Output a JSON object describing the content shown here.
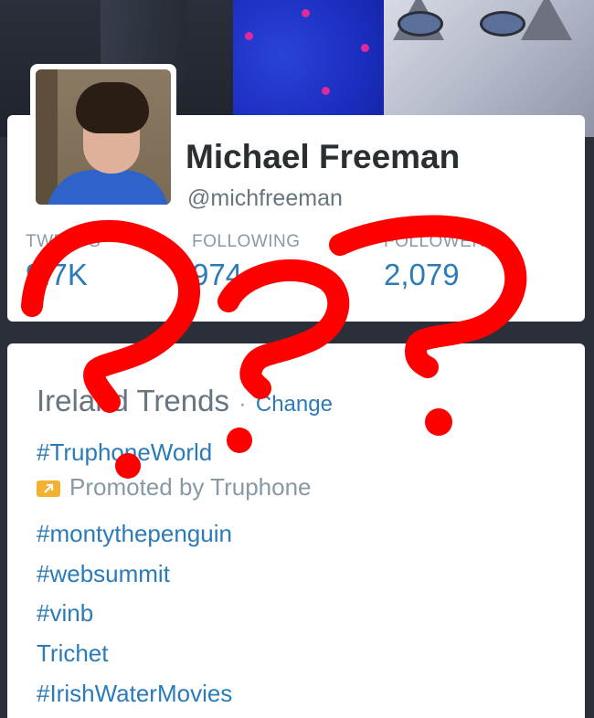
{
  "profile": {
    "name": "Michael Freeman",
    "handle": "@michfreeman",
    "stats": [
      {
        "label": "TWEETS",
        "value": "9.7K"
      },
      {
        "label": "FOLLOWING",
        "value": "974"
      },
      {
        "label": "FOLLOWERS",
        "value": "2,079"
      }
    ]
  },
  "trends": {
    "title": "Ireland Trends",
    "separator": "·",
    "change_label": "Change",
    "promoted_tag": "#TruphoneWorld",
    "promoted_text": "Promoted by Truphone",
    "items": [
      "#montythepenguin",
      "#websummit",
      "#vinb",
      "Trichet",
      "#IrishWaterMovies"
    ]
  },
  "colors": {
    "link": "#2b7bb9",
    "muted": "#8899a6",
    "name": "#292f33",
    "scribble": "#ff0000"
  },
  "icons": [
    "promoted-arrow-icon"
  ]
}
